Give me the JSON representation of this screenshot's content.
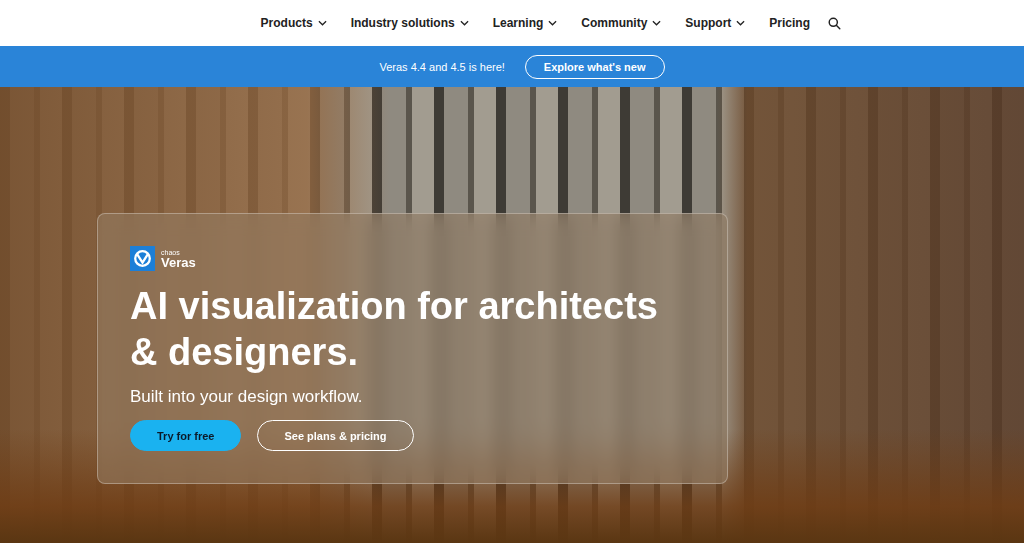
{
  "nav": {
    "items": [
      {
        "label": "Products",
        "dropdown": true
      },
      {
        "label": "Industry solutions",
        "dropdown": true
      },
      {
        "label": "Learning",
        "dropdown": true
      },
      {
        "label": "Community",
        "dropdown": true
      },
      {
        "label": "Support",
        "dropdown": true
      },
      {
        "label": "Pricing",
        "dropdown": false
      }
    ]
  },
  "banner": {
    "text": "Veras 4.4 and 4.5 is here!",
    "button": "Explore what's new"
  },
  "hero": {
    "logo": {
      "brand": "chaos",
      "product": "Veras"
    },
    "title": "AI visualization for architects & designers.",
    "subtitle": "Built into your design workflow.",
    "buttons": [
      {
        "label": "Try for free",
        "kind": "primary"
      },
      {
        "label": "See plans & pricing",
        "kind": "outline"
      }
    ]
  }
}
